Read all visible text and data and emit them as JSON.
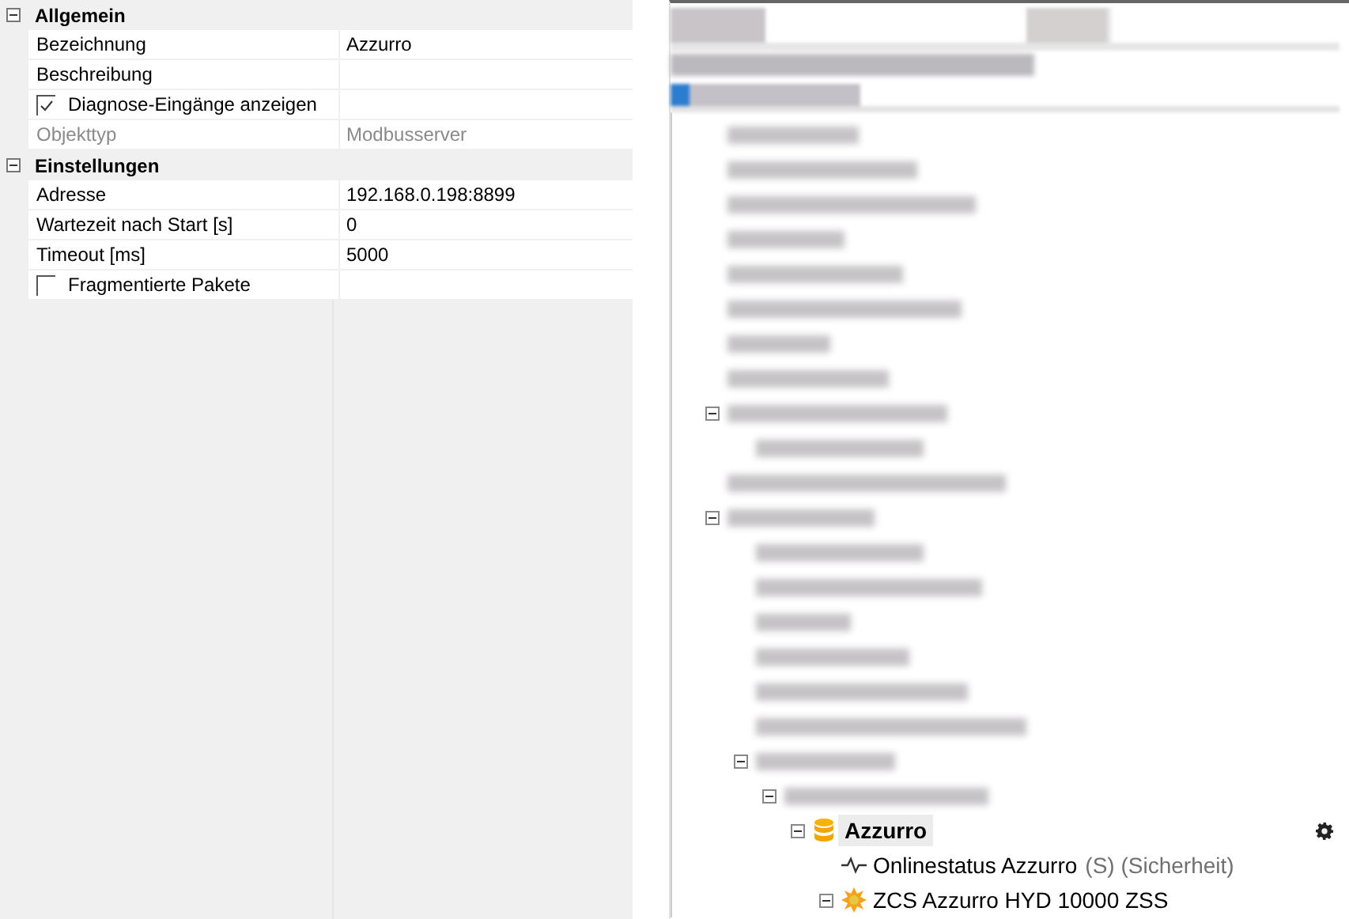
{
  "properties": {
    "sections": [
      {
        "title": "Allgemein",
        "expanded": true,
        "rows": [
          {
            "kind": "text",
            "label": "Bezeichnung",
            "value": "Azzurro",
            "disabled": false
          },
          {
            "kind": "text",
            "label": "Beschreibung",
            "disabled": false
          },
          {
            "kind": "checkbox",
            "label": "Diagnose-Eingänge anzeigen",
            "checked": true,
            "disabled": false
          },
          {
            "kind": "text",
            "label": "Objekttyp",
            "value": "Modbusserver",
            "disabled": true
          }
        ]
      },
      {
        "title": "Einstellungen",
        "expanded": true,
        "rows": [
          {
            "kind": "text",
            "label": "Adresse",
            "value": "192.168.0.198:8899",
            "disabled": false
          },
          {
            "kind": "text",
            "label": "Wartezeit nach Start [s]",
            "value": "0",
            "disabled": false
          },
          {
            "kind": "text",
            "label": "Timeout [ms]",
            "value": "5000",
            "disabled": false
          },
          {
            "kind": "checkbox",
            "label": "Fragmentierte Pakete",
            "checked": false,
            "disabled": false
          }
        ]
      }
    ]
  },
  "tree": {
    "items": [
      {
        "kind": "redacted"
      },
      {
        "kind": "redacted"
      },
      {
        "kind": "redacted"
      },
      {
        "kind": "redacted"
      },
      {
        "kind": "redacted"
      },
      {
        "kind": "redacted"
      },
      {
        "kind": "redacted"
      },
      {
        "kind": "redacted"
      },
      {
        "kind": "redacted",
        "children": [
          {
            "kind": "redacted"
          }
        ]
      },
      {
        "kind": "redacted"
      },
      {
        "kind": "redacted",
        "children": [
          {
            "kind": "redacted"
          },
          {
            "kind": "redacted"
          },
          {
            "kind": "redacted"
          },
          {
            "kind": "redacted"
          },
          {
            "kind": "redacted"
          },
          {
            "kind": "redacted"
          },
          {
            "kind": "redacted",
            "children": [
              {
                "kind": "redacted",
                "children": [
                  {
                    "kind": "database",
                    "label": "Azzurro",
                    "selected": true,
                    "expanded": true,
                    "children": [
                      {
                        "kind": "pulse",
                        "label": "Onlinestatus Azzurro",
                        "note": "(S) (Sicherheit)",
                        "selected": false
                      },
                      {
                        "kind": "device",
                        "label": "ZCS Azzurro HYD 10000 ZSS",
                        "selected": false,
                        "expanded": true
                      }
                    ]
                  }
                ]
              }
            ]
          }
        ]
      }
    ]
  }
}
